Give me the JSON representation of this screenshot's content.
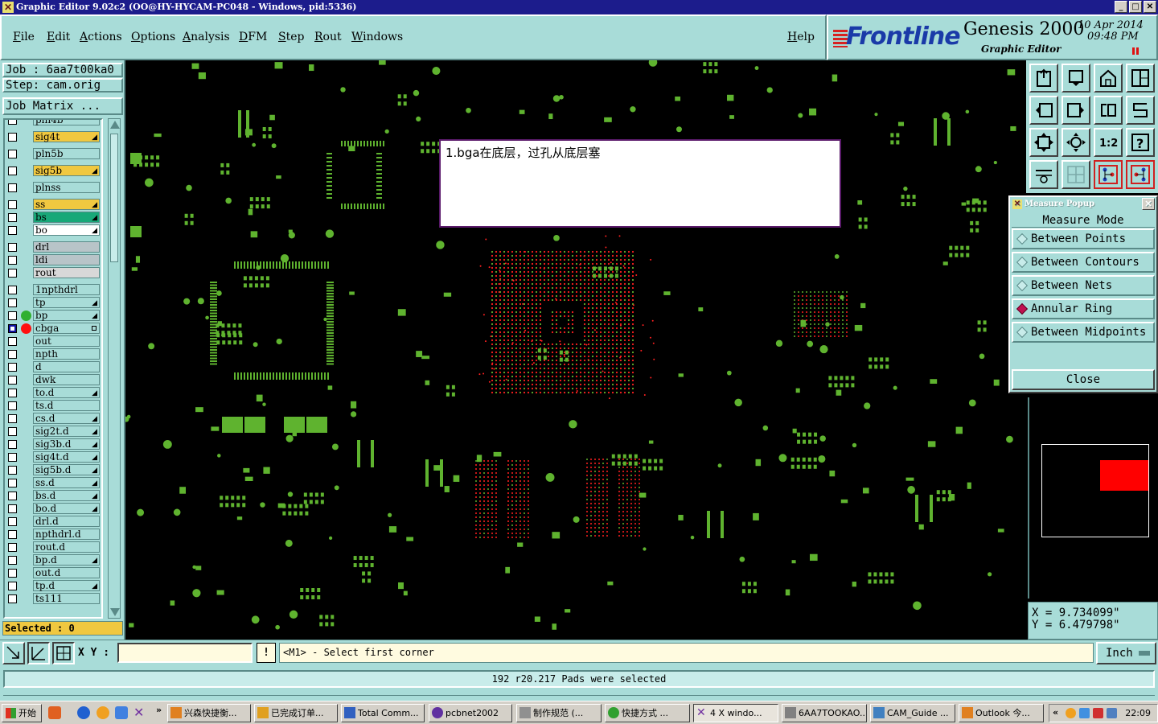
{
  "window": {
    "title": "Graphic Editor 9.02c2  (OO@HY-HYCAM-PC048 - Windows, pid:5336)",
    "controls": [
      "_",
      "□",
      "✕"
    ]
  },
  "menu": {
    "items": [
      "File",
      "Edit",
      "Actions",
      "Options",
      "Analysis",
      "DFM",
      "Step",
      "Rout",
      "Windows"
    ],
    "help": "Help"
  },
  "logo": {
    "brand": "Frontline",
    "product": "Genesis 2000",
    "subtitle": "Graphic Editor",
    "date": "10  Apr  2014",
    "time": "09:48  PM"
  },
  "job": {
    "job_label": "Job : 6aa7t00ka0",
    "step_label": "Step: cam.orig",
    "matrix_button": "Job Matrix ..."
  },
  "layers": [
    {
      "name": "pln4b",
      "color": "#a8dcd8",
      "checked": false,
      "mark": ""
    },
    {
      "name": "sig4t",
      "color": "#f0c840",
      "checked": false,
      "mark": "tick"
    },
    {
      "name": "pln5b",
      "color": "#a8dcd8",
      "checked": false,
      "mark": ""
    },
    {
      "name": "sig5b",
      "color": "#f0c840",
      "checked": false,
      "mark": "tick"
    },
    {
      "name": "plnss",
      "color": "#a8dcd8",
      "checked": false,
      "mark": ""
    },
    {
      "name": "ss",
      "color": "#f0c840",
      "checked": false,
      "mark": "tick"
    },
    {
      "name": "bs",
      "color": "#18a878",
      "checked": false,
      "mark": "tick"
    },
    {
      "name": "bo",
      "color": "#ffffff",
      "checked": false,
      "mark": "tick"
    },
    {
      "name": "drl",
      "color": "#b8c4c8",
      "checked": false,
      "mark": ""
    },
    {
      "name": "ldi",
      "color": "#b8c4c8",
      "checked": false,
      "mark": ""
    },
    {
      "name": "rout",
      "color": "#d8d8d8",
      "checked": false,
      "mark": ""
    },
    {
      "name": "1npthdrl",
      "color": "#a8dcd8",
      "checked": false,
      "mark": ""
    },
    {
      "name": "tp",
      "color": "#a8dcd8",
      "checked": false,
      "mark": "tick"
    },
    {
      "name": "bp",
      "color": "#a8dcd8",
      "checked": false,
      "mark": "tick",
      "dot": "#30b030"
    },
    {
      "name": "cbga",
      "color": "#a8dcd8",
      "checked": true,
      "mark": "box",
      "dot": "#ff1010"
    },
    {
      "name": "out",
      "color": "#a8dcd8",
      "checked": false,
      "mark": ""
    },
    {
      "name": "npth",
      "color": "#a8dcd8",
      "checked": false,
      "mark": ""
    },
    {
      "name": "d",
      "color": "#a8dcd8",
      "checked": false,
      "mark": ""
    },
    {
      "name": "dwk",
      "color": "#a8dcd8",
      "checked": false,
      "mark": ""
    },
    {
      "name": "to.d",
      "color": "#a8dcd8",
      "checked": false,
      "mark": "tick"
    },
    {
      "name": "ts.d",
      "color": "#a8dcd8",
      "checked": false,
      "mark": ""
    },
    {
      "name": "cs.d",
      "color": "#a8dcd8",
      "checked": false,
      "mark": "tick"
    },
    {
      "name": "sig2t.d",
      "color": "#a8dcd8",
      "checked": false,
      "mark": "tick"
    },
    {
      "name": "sig3b.d",
      "color": "#a8dcd8",
      "checked": false,
      "mark": "tick"
    },
    {
      "name": "sig4t.d",
      "color": "#a8dcd8",
      "checked": false,
      "mark": "tick"
    },
    {
      "name": "sig5b.d",
      "color": "#a8dcd8",
      "checked": false,
      "mark": "tick"
    },
    {
      "name": "ss.d",
      "color": "#a8dcd8",
      "checked": false,
      "mark": "tick"
    },
    {
      "name": "bs.d",
      "color": "#a8dcd8",
      "checked": false,
      "mark": "tick"
    },
    {
      "name": "bo.d",
      "color": "#a8dcd8",
      "checked": false,
      "mark": "tick"
    },
    {
      "name": "drl.d",
      "color": "#a8dcd8",
      "checked": false,
      "mark": ""
    },
    {
      "name": "npthdrl.d",
      "color": "#a8dcd8",
      "checked": false,
      "mark": ""
    },
    {
      "name": "rout.d",
      "color": "#a8dcd8",
      "checked": false,
      "mark": ""
    },
    {
      "name": "bp.d",
      "color": "#a8dcd8",
      "checked": false,
      "mark": "tick"
    },
    {
      "name": "out.d",
      "color": "#a8dcd8",
      "checked": false,
      "mark": ""
    },
    {
      "name": "tp.d",
      "color": "#a8dcd8",
      "checked": false,
      "mark": "tick"
    },
    {
      "name": "ts111",
      "color": "#a8dcd8",
      "checked": false,
      "mark": ""
    }
  ],
  "selected": "Selected : 0",
  "note": "1.bga在底层，过孔从底层塞",
  "tools": [
    {
      "icon": "zoom-home-icon"
    },
    {
      "icon": "pan-down-icon"
    },
    {
      "icon": "house-icon"
    },
    {
      "icon": "panel-layout-icon"
    },
    {
      "icon": "pan-left-icon"
    },
    {
      "icon": "pan-right-icon"
    },
    {
      "icon": "snap-icon"
    },
    {
      "icon": "route-icon"
    },
    {
      "icon": "fit-screen-icon"
    },
    {
      "icon": "center-icon"
    },
    {
      "icon": "scale-1-2-icon"
    },
    {
      "icon": "help-query-icon"
    },
    {
      "icon": "palette-icon"
    },
    {
      "icon": "grid-icon"
    },
    {
      "icon": "net-highlight-icon"
    },
    {
      "icon": "net-compare-icon"
    }
  ],
  "tool_labels": {
    "scale": "1:2",
    "query": "?"
  },
  "measure": {
    "title": "Measure Popup",
    "close_x": "✕",
    "mode_label": "Measure Mode",
    "options": [
      "Between Points",
      "Between Contours",
      "Between Nets",
      "Annular Ring",
      "Between Midpoints"
    ],
    "active_option": "Annular Ring",
    "close_button": "Close"
  },
  "coords": {
    "x": "X = 9.734099\"",
    "y": "Y = 6.479798\""
  },
  "command": {
    "xy_label": "X Y :",
    "xy_value": "",
    "bang": "!",
    "prompt": "<M1> - Select first corner",
    "unit": "Inch"
  },
  "status": "192 r20.217 Pads were selected",
  "taskbar": {
    "start": "开始",
    "quicklaunch_more": "»",
    "tasks": [
      {
        "label": "兴森快捷衡...",
        "icon": "#e08020"
      },
      {
        "label": "已完成订单...",
        "icon": "#e0a020"
      },
      {
        "label": "Total Comm...",
        "icon": "#3060c0"
      },
      {
        "label": "pcbnet2002",
        "icon": "#6030a0"
      },
      {
        "label": "制作规范 (...",
        "icon": "#606060"
      },
      {
        "label": "快捷方式 ...",
        "icon": "#30a030"
      },
      {
        "label": "4 X windo...",
        "icon": "#7030a0"
      },
      {
        "label": "6AA7TOOKAO...",
        "icon": "#808080"
      },
      {
        "label": "CAM_Guide ...",
        "icon": "#4080c0"
      },
      {
        "label": "Outlook 今...",
        "icon": "#e08020"
      }
    ],
    "tray_more": "«",
    "clock": "22:09"
  },
  "colors": {
    "panel": "#a8dcd8",
    "pad_green": "#5fb32f",
    "pad_red": "#ff2020",
    "canvas": "#000000",
    "highlight_yellow": "#f0c840"
  }
}
